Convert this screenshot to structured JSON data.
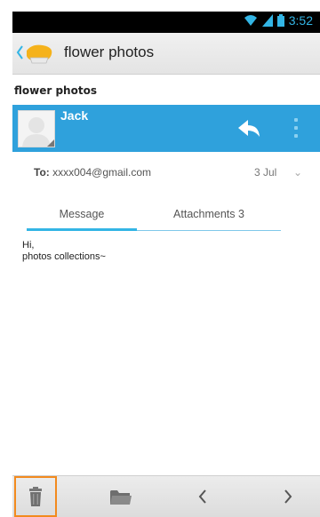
{
  "status_bar": {
    "time": "3:52"
  },
  "action_bar": {
    "title": "flower photos"
  },
  "message": {
    "subject": "flower photos",
    "sender": "Jack",
    "to_label": "To:",
    "to_address": "xxxx004@gmail.com",
    "date": "3 Jul",
    "body_line1": "Hi,",
    "body_line2": "photos collections~"
  },
  "tabs": {
    "message": "Message",
    "attachments": "Attachments 3"
  },
  "icons": {
    "app": "email-app-icon",
    "reply": "reply-icon",
    "more": "overflow-menu-icon",
    "trash": "trash-icon",
    "folder": "folder-icon",
    "prev": "chevron-left-icon",
    "next": "chevron-right-icon"
  },
  "colors": {
    "accent": "#33b5e5",
    "sender_bar": "#2fa1dc",
    "highlight": "#f28a1e"
  }
}
